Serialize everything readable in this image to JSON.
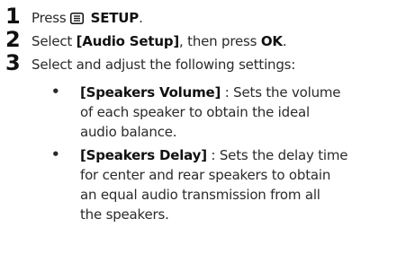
{
  "steps": [
    {
      "number": "1",
      "prefix": "Press ",
      "key_icon": "menu-setup-icon",
      "key_label": "SETUP",
      "suffix": "."
    },
    {
      "number": "2",
      "prefix": "Select ",
      "option": "[Audio Setup]",
      "middle": ", then press ",
      "key_label": "OK",
      "suffix": "."
    },
    {
      "number": "3",
      "text": "Select and adjust the following settings:"
    }
  ],
  "bullets": [
    {
      "marker": "•",
      "term": "[Speakers Volume]",
      "lines": [
        " : Sets the volume",
        "of each speaker to obtain the ideal",
        "audio balance."
      ]
    },
    {
      "marker": "•",
      "term": "[Speakers Delay]",
      "lines": [
        " : Sets the delay time",
        "for center and rear speakers to obtain",
        "an equal audio transmission from all",
        "the speakers."
      ]
    }
  ]
}
